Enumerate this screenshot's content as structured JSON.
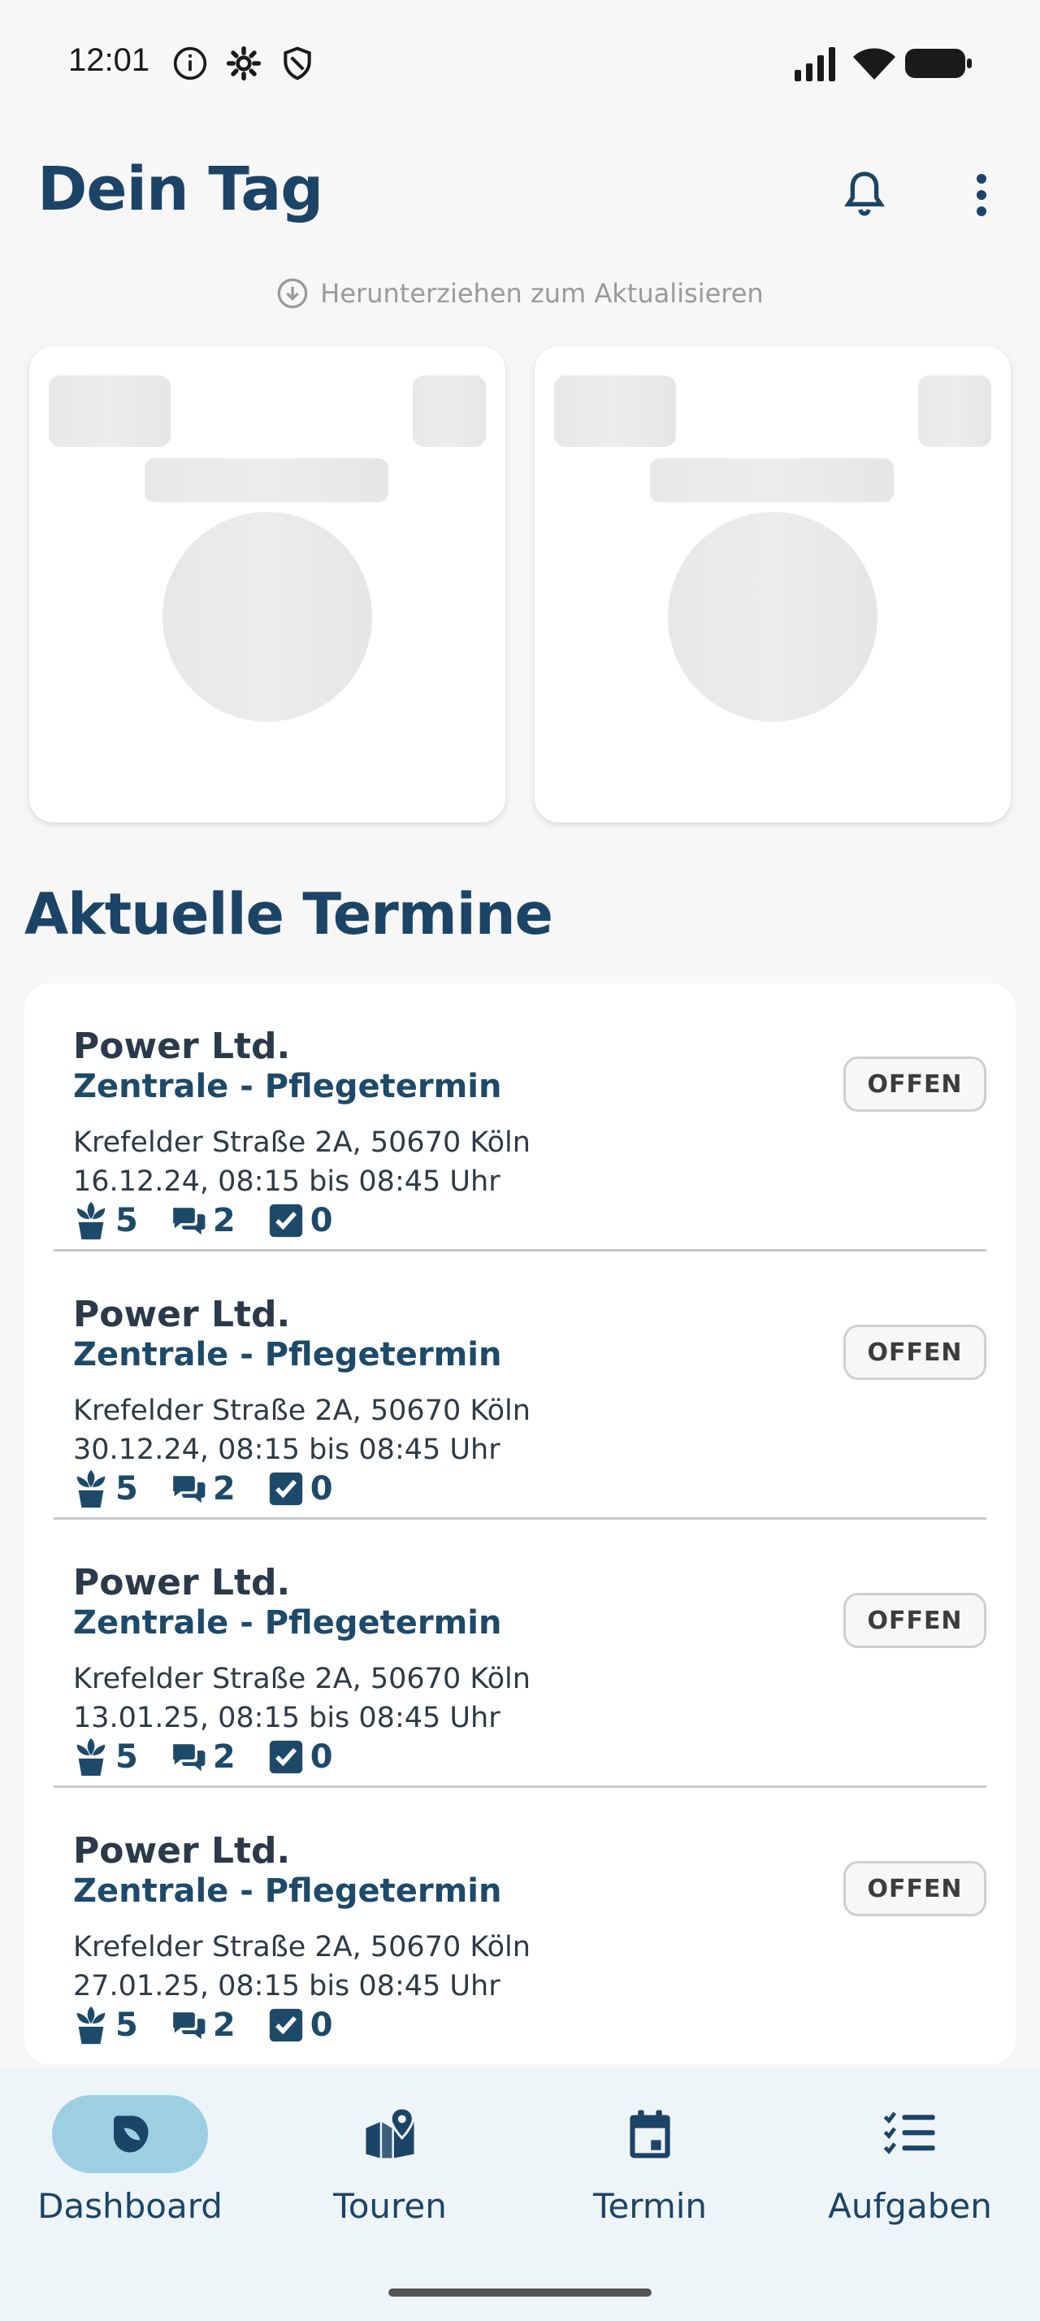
{
  "status_bar": {
    "time": "12:01",
    "left_icons": [
      "info-icon",
      "gear-icon",
      "shield-icon"
    ],
    "right_icons": [
      "signal-icon",
      "wifi-icon",
      "battery-icon"
    ]
  },
  "header": {
    "title": "Dein Tag",
    "bell_icon": "bell-icon",
    "more_icon": "more-vertical-icon"
  },
  "pull_hint": {
    "text": "Herunterziehen zum Aktualisieren",
    "icon": "arrow-down-circle-icon"
  },
  "section_title": "Aktuelle Termine",
  "appointments": [
    {
      "company": "Power Ltd.",
      "type": "Zentrale - Pflegetermin",
      "address": "Krefelder Straße 2A, 50670 Köln",
      "time": "16.12.24, 08:15 bis 08:45 Uhr",
      "status": "OFFEN",
      "plants": "5",
      "comments": "2",
      "tasks": "0"
    },
    {
      "company": "Power Ltd.",
      "type": "Zentrale - Pflegetermin",
      "address": "Krefelder Straße 2A, 50670 Köln",
      "time": "30.12.24, 08:15 bis 08:45 Uhr",
      "status": "OFFEN",
      "plants": "5",
      "comments": "2",
      "tasks": "0"
    },
    {
      "company": "Power Ltd.",
      "type": "Zentrale - Pflegetermin",
      "address": "Krefelder Straße 2A, 50670 Köln",
      "time": "13.01.25, 08:15 bis 08:45 Uhr",
      "status": "OFFEN",
      "plants": "5",
      "comments": "2",
      "tasks": "0"
    },
    {
      "company": "Power Ltd.",
      "type": "Zentrale - Pflegetermin",
      "address": "Krefelder Straße 2A, 50670 Köln",
      "time": "27.01.25, 08:15 bis 08:45 Uhr",
      "status": "OFFEN",
      "plants": "5",
      "comments": "2",
      "tasks": "0"
    }
  ],
  "bottom_nav": [
    {
      "label": "Dashboard",
      "icon": "dashboard-leaf-icon",
      "active": true
    },
    {
      "label": "Touren",
      "icon": "map-pin-icon",
      "active": false
    },
    {
      "label": "Termin",
      "icon": "calendar-icon",
      "active": false
    },
    {
      "label": "Aufgaben",
      "icon": "checklist-icon",
      "active": false
    }
  ],
  "colors": {
    "brand": "#1c4466",
    "background": "#f7f7f7",
    "nav_background": "#eef5f9",
    "nav_active": "#9dcfe3"
  }
}
